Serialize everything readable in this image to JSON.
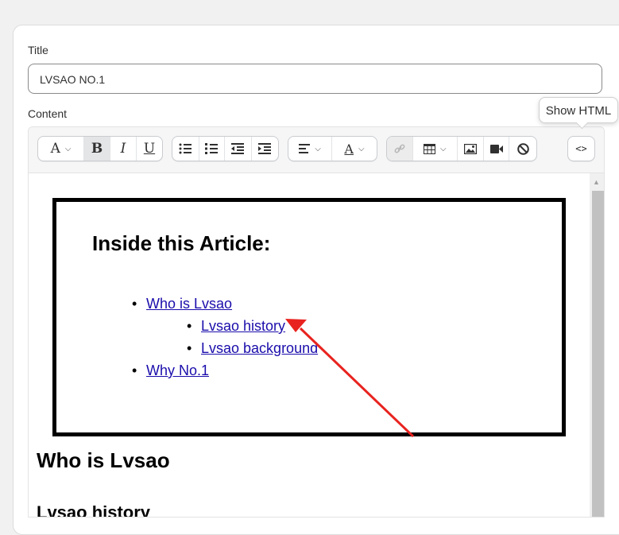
{
  "form": {
    "title_label": "Title",
    "title_value": "LVSAO NO.1",
    "content_label": "Content"
  },
  "toolbar": {
    "font_label": "A",
    "bold_label": "B",
    "italic_label": "I",
    "underline_label": "U",
    "text_color_label": "A",
    "html_toggle_label": "<>"
  },
  "tooltip": {
    "text": "Show HTML"
  },
  "editor": {
    "toc_heading": "Inside this Article:",
    "toc_items": [
      {
        "label": "Who is Lvsao"
      },
      {
        "label": "Lvsao history"
      },
      {
        "label": "Lvsao background"
      },
      {
        "label": "Why No.1"
      }
    ],
    "section_heading": "Who is Lvsao",
    "subsection_heading": "Lvsao history"
  },
  "colors": {
    "link": "#1a0dab",
    "arrow": "#e8231f"
  }
}
